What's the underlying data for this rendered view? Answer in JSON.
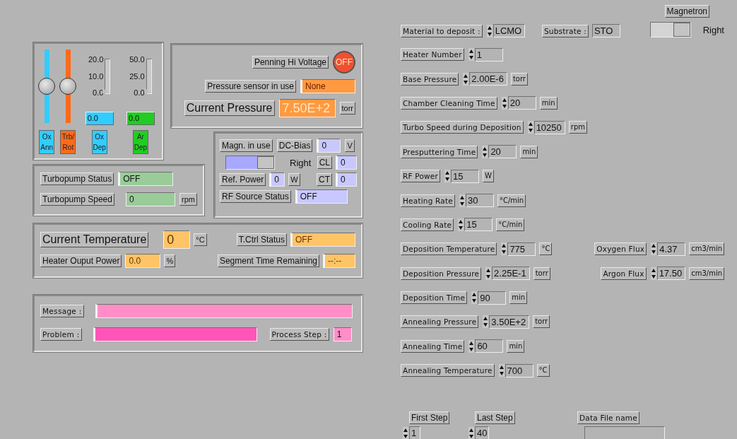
{
  "flow_panel": {
    "sliders": [
      {
        "label": "Ox Ann",
        "color": "#33ccff",
        "level": 0.5
      },
      {
        "label": "Trb/ Rot",
        "color": "#ff6a1a",
        "level": 0.5
      }
    ],
    "gauges": [
      {
        "label": "Ox Dep",
        "color": "#33ccff",
        "ticks": [
          "20.0",
          "10.0",
          "0.0"
        ],
        "level": 0,
        "reading": "0.0"
      },
      {
        "label": "Ar Dep",
        "color": "#22cc22",
        "ticks": [
          "50.0",
          "25.0",
          "0.0"
        ],
        "level": 0,
        "reading": "0.0"
      }
    ]
  },
  "pressure_panel": {
    "penning": {
      "label": "Penning Hi Voltage",
      "value": "OFF",
      "on": false
    },
    "sensor": {
      "label": "Pressure sensor in use",
      "value": "None"
    },
    "current": {
      "label": "Current Pressure",
      "value": "7.50E+2",
      "unit": "torr"
    }
  },
  "magnetron_panel": {
    "magn": {
      "label": "Magn. in use"
    },
    "dc_bias": {
      "label": "DC-Bias",
      "value": "0",
      "unit": "V"
    },
    "switch": {
      "label": "Right",
      "on": true
    },
    "cl": {
      "label": "CL",
      "value": "0"
    },
    "ref_power": {
      "label": "Ref. Power",
      "value": "0",
      "unit": "W"
    },
    "ct": {
      "label": "CT",
      "value": "0"
    },
    "rf_status": {
      "label": "RF Source Status",
      "value": "OFF"
    }
  },
  "turbopump_panel": {
    "status": {
      "label": "Turbopump Status",
      "value": "OFF"
    },
    "speed": {
      "label": "Turbopump Speed",
      "value": "0",
      "unit": "rpm"
    }
  },
  "temperature_panel": {
    "current": {
      "label": "Current Temperature",
      "value": "0",
      "unit": "°C"
    },
    "ctrl_status": {
      "label": "T.Ctrl Status",
      "value": "OFF"
    },
    "heater_power": {
      "label": "Heater Ouput Power",
      "value": "0.0",
      "unit": "%"
    },
    "segment": {
      "label": "Segment Time Remaining",
      "value": "--:--"
    }
  },
  "message_panel": {
    "message": {
      "label": "Message :"
    },
    "problem": {
      "label": "Problem :"
    },
    "process_step": {
      "label": "Process Step :",
      "value": "1"
    }
  },
  "recipe": {
    "magnetron": {
      "label": "Magnetron",
      "switch_label": "Right",
      "on": true
    },
    "rows": [
      [
        {
          "kind": "numeric",
          "label": "Material to deposit :",
          "value": "LCMO"
        },
        {
          "kind": "string",
          "label": "Substrate :",
          "value": "STO"
        }
      ],
      [
        {
          "kind": "numeric",
          "label": "Heater Number",
          "value": "1"
        }
      ],
      [
        {
          "kind": "numeric",
          "label": "Base Pressure",
          "value": "2.00E-6",
          "unit": "torr"
        }
      ],
      [
        {
          "kind": "numeric",
          "label": "Chamber Cleaning Time",
          "value": "20",
          "unit": "min"
        }
      ],
      [
        {
          "kind": "numeric",
          "label": "Turbo Speed during Deposition",
          "value": "10250",
          "unit": "rpm"
        }
      ],
      [
        {
          "kind": "numeric",
          "label": "Presputtering Time",
          "value": "20",
          "unit": "min"
        }
      ],
      [
        {
          "kind": "numeric",
          "label": "RF Power",
          "value": "15",
          "unit": "W"
        }
      ],
      [
        {
          "kind": "numeric",
          "label": "Heating Rate",
          "value": "30",
          "unit": "°C/min"
        }
      ],
      [
        {
          "kind": "numeric",
          "label": "Cooling Rate",
          "value": "15",
          "unit": "°C/min"
        }
      ],
      [
        {
          "kind": "numeric",
          "label": "Deposition Temperature",
          "value": "775",
          "unit": "°C"
        },
        {
          "kind": "numeric",
          "label": "Oxygen Flux",
          "value": "4.37",
          "unit": "cm3/min"
        }
      ],
      [
        {
          "kind": "numeric",
          "label": "Deposition Pressure",
          "value": "2.25E-1",
          "unit": "torr"
        },
        {
          "kind": "numeric",
          "label": "Argon Flux",
          "value": "17.50",
          "unit": "cm3/min"
        }
      ],
      [
        {
          "kind": "numeric",
          "label": "Deposition Time",
          "value": "90",
          "unit": "min"
        }
      ],
      [
        {
          "kind": "numeric",
          "label": "Annealing Pressure",
          "value": "3.50E+2",
          "unit": "torr"
        }
      ],
      [
        {
          "kind": "numeric",
          "label": "Annealing Time",
          "value": "60",
          "unit": "min"
        }
      ],
      [
        {
          "kind": "numeric",
          "label": "Annealing Temperature",
          "value": "700",
          "unit": "°C"
        }
      ]
    ]
  },
  "steps": [
    {
      "label": "First Step",
      "value": "1"
    },
    {
      "label": "Last Step",
      "value": "40"
    }
  ],
  "data_file": {
    "label": "Data File name"
  }
}
